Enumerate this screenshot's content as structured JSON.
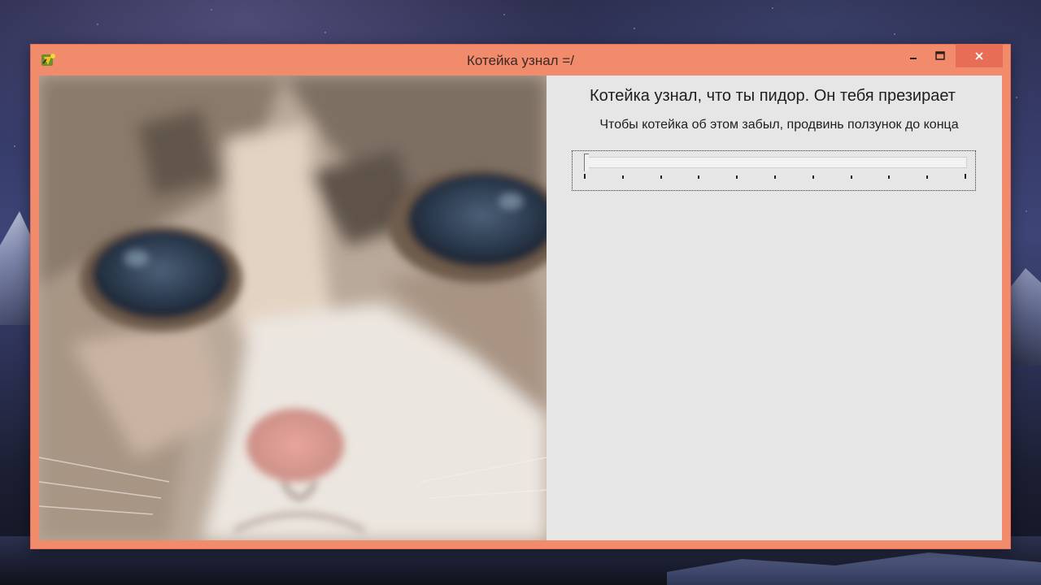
{
  "window": {
    "title": "Котейка узнал =/",
    "buttons": {
      "minimize_icon": "minimize-icon",
      "maximize_icon": "maximize-icon",
      "close_icon": "close-icon"
    },
    "frame_color": "#f28a6c",
    "close_color": "#e86d56"
  },
  "content": {
    "message_title": "Котейка узнал, что ты пидор. Он тебя презирает",
    "message_subtitle": "Чтобы котейка об этом забыл, продвинь ползунок до конца",
    "photo_icon": "cat-photo"
  },
  "slider": {
    "value": 0,
    "min": 0,
    "max": 10,
    "tick_count": 11
  }
}
